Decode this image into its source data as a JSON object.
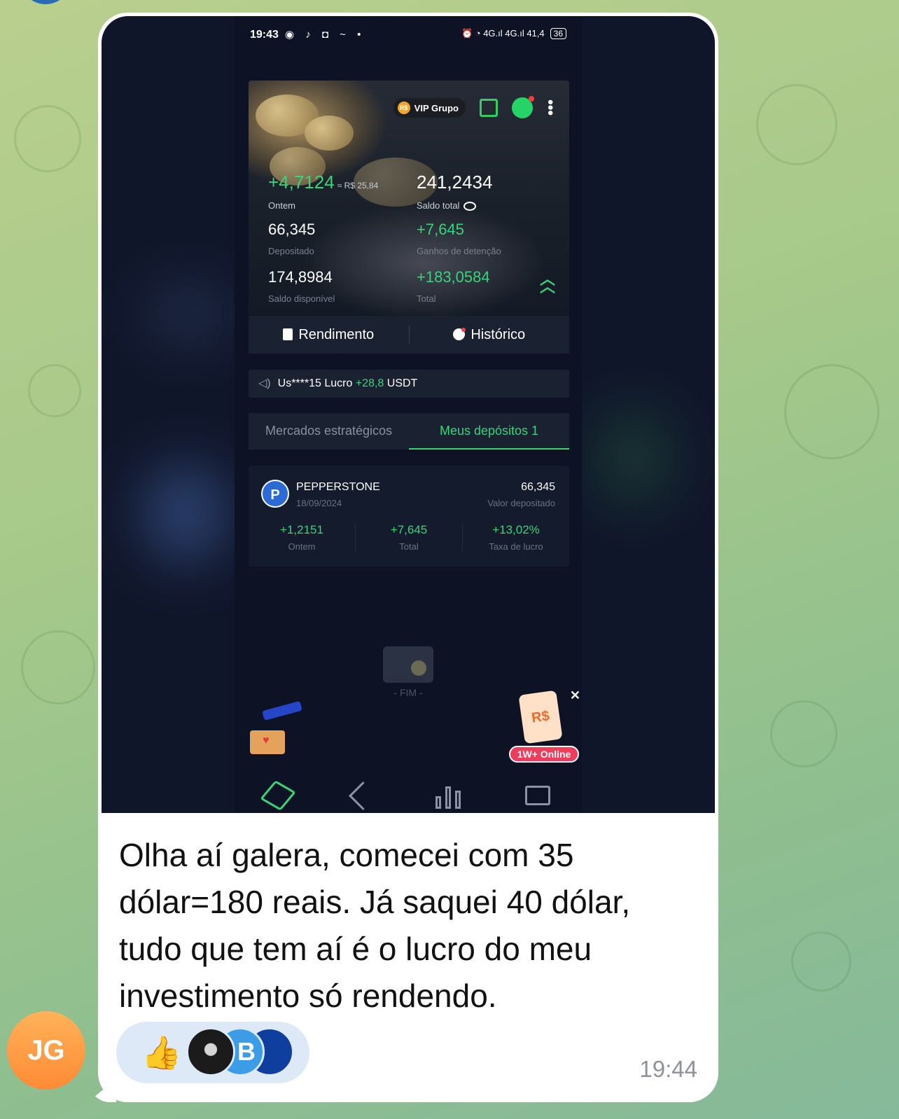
{
  "app_screenshot": {
    "status_bar": {
      "time": "19:43",
      "left_icons": "◉ ♪ ◘ ~ •",
      "right_icons": "⏰ ◔ 4G.ıl 4G.ıl 41,4",
      "battery": "36"
    },
    "header": {
      "vip_badge_currency": "R$",
      "vip_label": "VIP Grupo"
    },
    "stats": {
      "yesterday_value": "+4,7124",
      "yesterday_brl": "≈ R$ 25,84",
      "yesterday_label": "Ontem",
      "total_balance_value": "241,2434",
      "total_balance_label": "Saldo total",
      "deposited_value": "66,345",
      "deposited_label": "Depositado",
      "holding_gains_value": "+7,645",
      "holding_gains_label": "Ganhos de detenção",
      "available_value": "174,8984",
      "available_label": "Saldo disponível",
      "total_value": "+183,0584",
      "total_label": "Total"
    },
    "tabs": {
      "rendimento": "Rendimento",
      "historico": "Histórico"
    },
    "ticker": {
      "user": "Us****15 Lucro",
      "amount": "+28,8",
      "currency": "USDT"
    },
    "segments": {
      "strategic": "Mercados estratégicos",
      "my_deposits": "Meus depósitos 1"
    },
    "deposit_card": {
      "logo_letter": "P",
      "name": "PEPPERSTONE",
      "date": "18/09/2024",
      "amount": "66,345",
      "amount_label": "Valor depositado",
      "yesterday_value": "+1,2151",
      "yesterday_label": "Ontem",
      "total_value": "+7,645",
      "total_label": "Total",
      "rate_value": "+13,02%",
      "rate_label": "Taxa de lucro"
    },
    "end_label": "- FIM -",
    "promo": {
      "currency": "R$",
      "online": "1W+ Online",
      "close": "✕"
    }
  },
  "message": {
    "caption": "Olha aí galera, comecei com 35 dólar=180 reais. Já saquei 40 dólar, tudo que tem aí é o lucro do meu investimento só rendendo.",
    "reaction_emoji": "👍",
    "reactor_initial": "B",
    "time": "19:44",
    "sender_initials": "JG"
  },
  "colors": {
    "accent_green": "#37d47a",
    "bubble_bg": "#ffffff",
    "reaction_bg": "#dde9f7",
    "avatar_orange": "#ff8a35"
  }
}
